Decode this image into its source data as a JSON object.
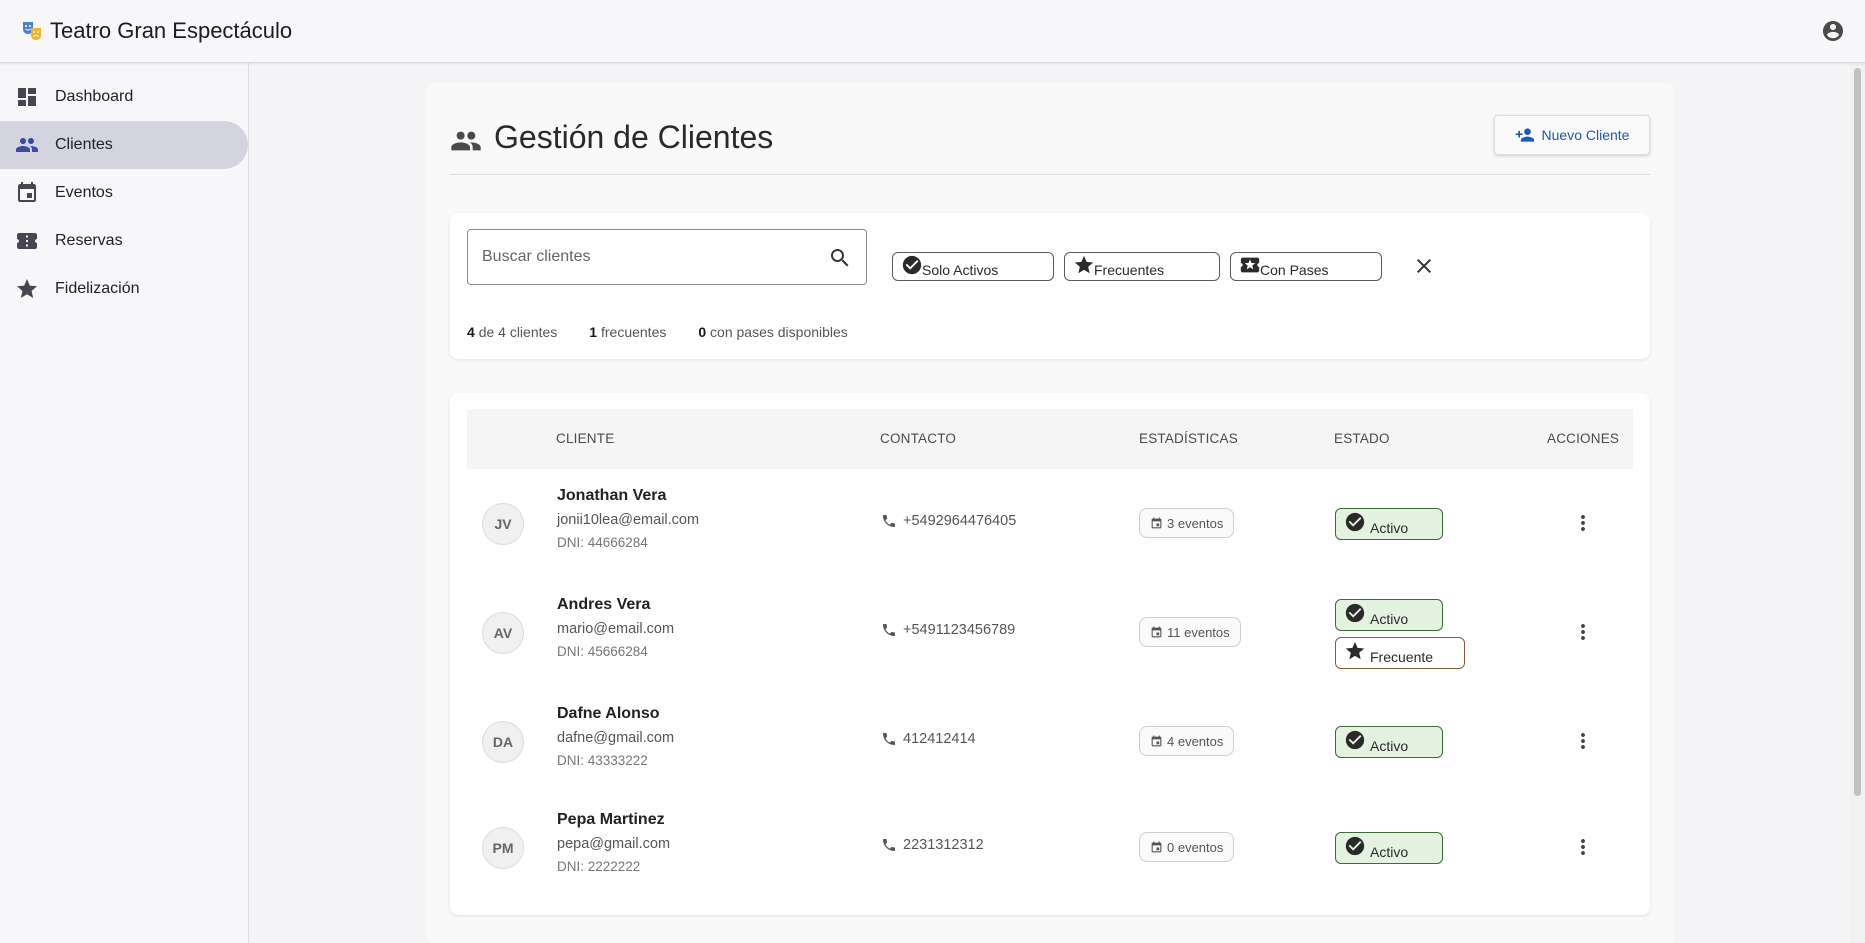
{
  "app": {
    "title": "Teatro Gran Espectáculo"
  },
  "sidebar": {
    "items": [
      {
        "label": "Dashboard",
        "icon": "dashboard-icon",
        "active": false
      },
      {
        "label": "Clientes",
        "icon": "people-icon",
        "active": true
      },
      {
        "label": "Eventos",
        "icon": "calendar-icon",
        "active": false
      },
      {
        "label": "Reservas",
        "icon": "ticket-icon",
        "active": false
      },
      {
        "label": "Fidelización",
        "icon": "star-icon",
        "active": false
      }
    ]
  },
  "page": {
    "title": "Gestión de Clientes",
    "new_button": "Nuevo Cliente"
  },
  "filters": {
    "search_placeholder": "Buscar clientes",
    "chips": [
      "Solo Activos",
      "Frecuentes",
      "Con Pases"
    ]
  },
  "counts": {
    "shown": "4",
    "shown_text": "de 4 clientes",
    "frequent": "1",
    "frequent_text": "frecuentes",
    "passes": "0",
    "passes_text": "con pases disponibles"
  },
  "table": {
    "columns": [
      "CLIENTE",
      "CONTACTO",
      "ESTADÍSTICAS",
      "ESTADO",
      "ACCIONES"
    ],
    "rows": [
      {
        "initials": "JV",
        "name": "Jonathan Vera",
        "email": "jonii10lea@email.com",
        "dni": "DNI: 44666284",
        "phone": "+5492964476405",
        "events": "3 eventos",
        "status": [
          "Activo"
        ]
      },
      {
        "initials": "AV",
        "name": "Andres Vera",
        "email": "mario@email.com",
        "dni": "DNI: 45666284",
        "phone": "+5491123456789",
        "events": "11 eventos",
        "status": [
          "Activo",
          "Frecuente"
        ]
      },
      {
        "initials": "DA",
        "name": "Dafne Alonso",
        "email": "dafne@gmail.com",
        "dni": "DNI: 43333222",
        "phone": "412412414",
        "events": "4 eventos",
        "status": [
          "Activo"
        ]
      },
      {
        "initials": "PM",
        "name": "Pepa Martinez",
        "email": "pepa@gmail.com",
        "dni": "DNI: 2222222",
        "phone": "2231312312",
        "events": "0 eventos",
        "status": [
          "Activo"
        ]
      }
    ]
  },
  "colors": {
    "accent": "#3b4ba0",
    "button_text": "#1a59b8",
    "active_bg": "#e4f2e0",
    "active_border": "#3d6b3a",
    "frequent_border": "#8b5a3a"
  }
}
